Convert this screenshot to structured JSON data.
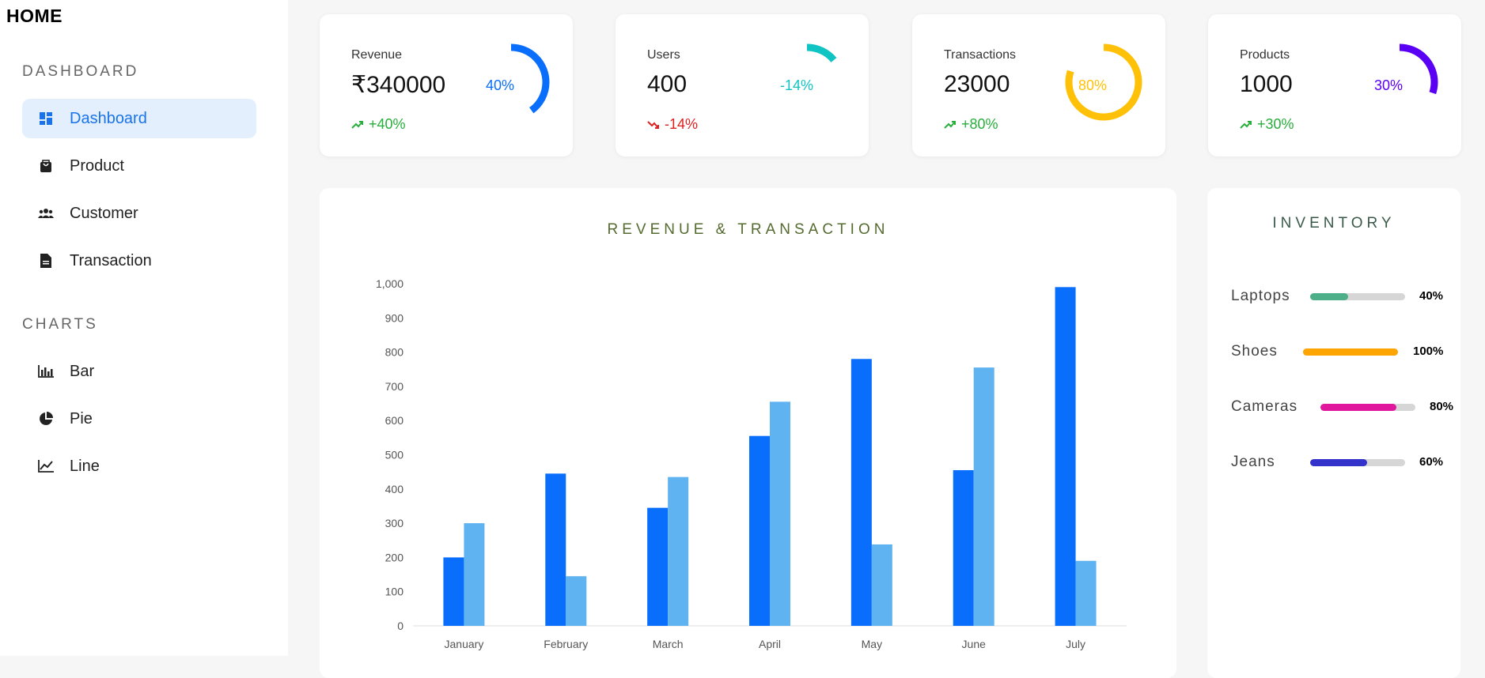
{
  "app": {
    "logo": "HOME"
  },
  "sidebar": {
    "sections": [
      {
        "title": "DASHBOARD",
        "items": [
          {
            "label": "Dashboard",
            "icon": "dashboard-icon",
            "active": true
          },
          {
            "label": "Product",
            "icon": "shopping-bag-icon"
          },
          {
            "label": "Customer",
            "icon": "people-icon"
          },
          {
            "label": "Transaction",
            "icon": "document-icon"
          }
        ]
      },
      {
        "title": "CHARTS",
        "items": [
          {
            "label": "Bar",
            "icon": "bar-chart-icon"
          },
          {
            "label": "Pie",
            "icon": "pie-chart-icon"
          },
          {
            "label": "Line",
            "icon": "line-chart-icon"
          }
        ]
      }
    ]
  },
  "widgets": [
    {
      "title": "Revenue",
      "value": "₹340000",
      "change": "+40%",
      "trend": "up",
      "percent": "40%",
      "percent_value": 40,
      "color": "#0a6efc"
    },
    {
      "title": "Users",
      "value": "400",
      "change": "-14%",
      "trend": "down",
      "percent": "-14%",
      "percent_value": 14,
      "color": "#11c4c4"
    },
    {
      "title": "Transactions",
      "value": "23000",
      "change": "+80%",
      "trend": "up",
      "percent": "80%",
      "percent_value": 80,
      "color": "#ffc107"
    },
    {
      "title": "Products",
      "value": "1000",
      "change": "+30%",
      "trend": "up",
      "percent": "30%",
      "percent_value": 30,
      "color": "#5a00f5"
    }
  ],
  "chart_data": {
    "type": "bar",
    "title": "REVENUE & TRANSACTION",
    "categories": [
      "January",
      "February",
      "March",
      "April",
      "May",
      "June",
      "July"
    ],
    "series": [
      {
        "values": [
          200,
          445,
          345,
          555,
          780,
          455,
          990
        ],
        "color": "#0a6efc"
      },
      {
        "values": [
          300,
          145,
          435,
          655,
          238,
          755,
          190
        ],
        "color": "#5eb3f0"
      }
    ],
    "ylim": [
      0,
      1000
    ],
    "yticks": [
      "0",
      "100",
      "200",
      "300",
      "400",
      "500",
      "600",
      "700",
      "800",
      "900",
      "1,000"
    ],
    "grid": false
  },
  "inventory": {
    "title": "INVENTORY",
    "items": [
      {
        "name": "Laptops",
        "percent": "40%",
        "value": 0.4,
        "color": "#4caf8a"
      },
      {
        "name": "Shoes",
        "percent": "100%",
        "value": 1.0,
        "color": "#ffa500"
      },
      {
        "name": "Cameras",
        "percent": "80%",
        "value": 0.8,
        "color": "#e0179c"
      },
      {
        "name": "Jeans",
        "percent": "60%",
        "value": 0.6,
        "color": "#3333cc"
      }
    ]
  }
}
